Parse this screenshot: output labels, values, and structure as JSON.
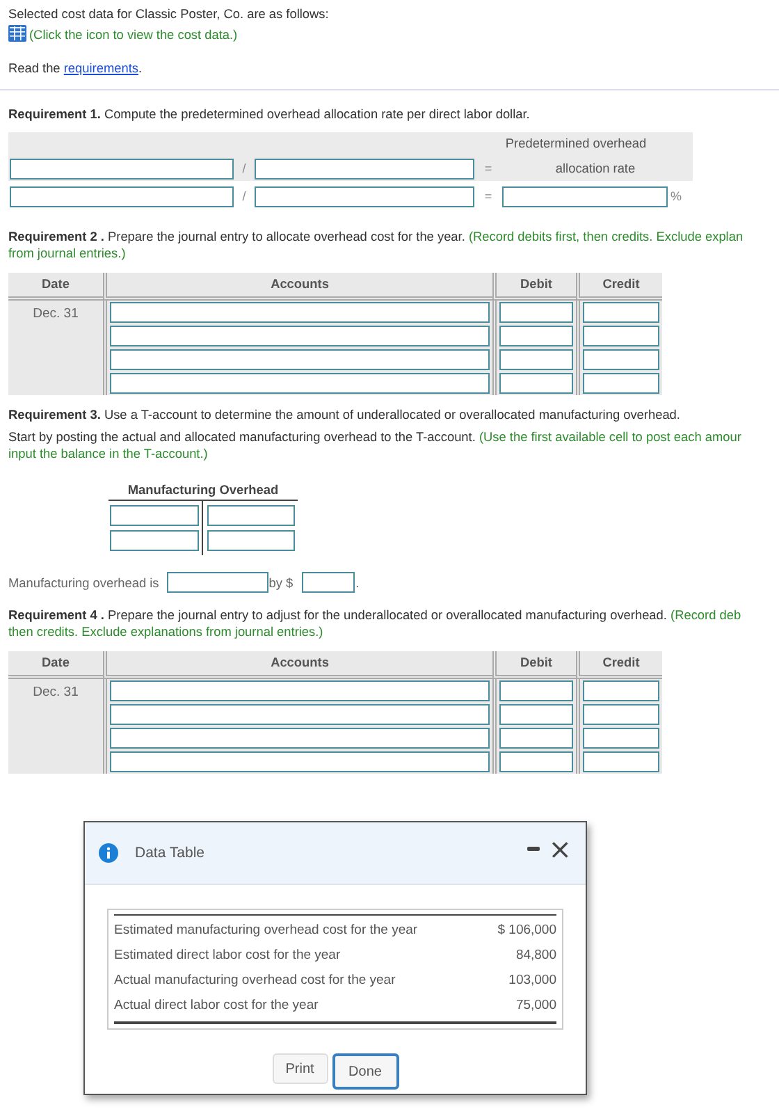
{
  "intro": {
    "text": "Selected cost data for Classic Poster, Co. are as follows:",
    "link": "(Click the icon to view the cost data.)"
  },
  "read": {
    "text": "Read the",
    "link": "requirements",
    "end": "."
  },
  "requirement_1": {
    "heading": "Requirement 1.",
    "text": "Compute the predetermined overhead allocation rate per direct labor dollar.",
    "result_label_lines": [
      "Predetermined overhead",
      "allocation rate"
    ],
    "divide": "/",
    "equals": "=",
    "unit": "%"
  },
  "requirement_2": {
    "heading": "Requirement 2 .",
    "text": "Prepare the journal entry to allocate overhead cost for the year.",
    "note_lines": [
      "(Record debits first, then credits. Exclude explan",
      "from journal entries.)"
    ],
    "journal": {
      "columns": [
        "Date",
        "Accounts",
        "Debit",
        "Credit"
      ],
      "date": "Dec. 31"
    }
  },
  "requirement_3": {
    "heading": "Requirement 3.",
    "text": "Use a T-account to determine the amount of underallocated or overallocated manufacturing overhead.",
    "start_text": "Start by posting the actual and allocated manufacturing overhead to the T-account.",
    "note_lines": [
      "(Use the first available cell to post each amour",
      "input the balance in the T-account.)"
    ],
    "t_account": {
      "title": "Manufacturing Overhead"
    },
    "result": {
      "text": "Manufacturing overhead is",
      "by": "by $",
      "end": "."
    }
  },
  "requirement_4": {
    "heading": "Requirement 4 .",
    "text": "Prepare the journal entry to adjust for the underallocated or overallocated manufacturing overhead.",
    "note_lines": [
      "(Record deb",
      "then credits. Exclude explanations from journal entries.)"
    ],
    "journal": {
      "columns": [
        "Date",
        "Accounts",
        "Debit",
        "Credit"
      ],
      "date": "Dec. 31"
    }
  },
  "dialog": {
    "title": "Data Table",
    "close": "×",
    "rows": [
      {
        "label": "Estimated manufacturing overhead cost for the year",
        "currency": "$",
        "amount": "106,000"
      },
      {
        "label": "Estimated direct labor cost for the year",
        "amount": "84,800"
      },
      {
        "label": "Actual manufacturing overhead cost for the year",
        "amount": "103,000"
      },
      {
        "label": "Actual direct labor cost for the year",
        "amount": "75,000"
      }
    ],
    "buttons": [
      {
        "label": "Print",
        "focused": false
      },
      {
        "label": "Done",
        "focused": true
      }
    ]
  }
}
